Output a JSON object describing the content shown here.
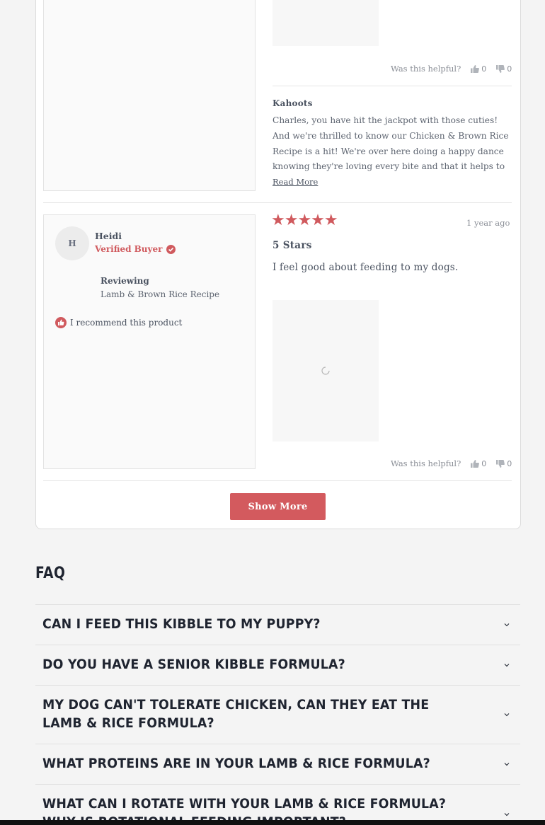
{
  "review_prev": {
    "helpful_label": "Was this helpful?",
    "yes_count": "0",
    "no_count": "0",
    "reply": {
      "name": "Kahoots",
      "lines": [
        "Charles, you have hit the jackpot with those cuties!",
        "And we're thrilled to know our Chicken & Brown Rice",
        "Recipe is a hit! We're over here doing a happy dance",
        "knowing they're loving every bite and that it helps to"
      ],
      "read_more": "Read More"
    }
  },
  "review": {
    "avatar_initial": "H",
    "name": "Heidi",
    "verified": "Verified Buyer",
    "reviewing_label": "Reviewing",
    "product": "Lamb & Brown Rice Recipe",
    "recommend": "I recommend this product",
    "stars": "★★★★★",
    "rating": 5,
    "date": "1 year ago",
    "title": "5 Stars",
    "body": "I feel good about feeding to my dogs.",
    "helpful_label": "Was this helpful?",
    "yes_count": "0",
    "no_count": "0"
  },
  "show_more": "Show More",
  "faq": {
    "title": "FAQ",
    "items": [
      "CAN I FEED THIS KIBBLE TO MY PUPPY?",
      "DO YOU HAVE A SENIOR KIBBLE FORMULA?",
      "MY DOG CAN'T TOLERATE CHICKEN, CAN THEY EAT THE LAMB & RICE FORMULA?",
      "WHAT PROTEINS ARE IN YOUR LAMB & RICE FORMULA?",
      "WHAT CAN I ROTATE WITH YOUR LAMB & RICE FORMULA? WHY IS ROTATIONAL FEEDING IMPORTANT?"
    ]
  },
  "colors": {
    "accent": "#d35a5e",
    "text": "#4a5260",
    "heading": "#1f2430"
  },
  "icons": {
    "thumbs_up": "thumbs-up-icon",
    "thumbs_down": "thumbs-down-icon",
    "verified": "check-circle-icon",
    "recommend": "thumbs-up-badge-icon",
    "loading": "loading-spinner-icon",
    "chevron": "chevron-down-icon"
  }
}
